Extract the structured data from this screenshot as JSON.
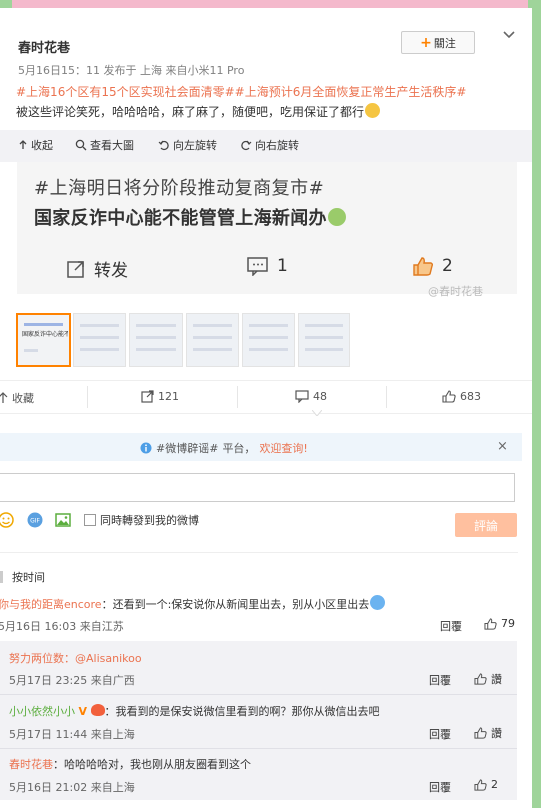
{
  "post": {
    "author": "舂时花巷",
    "follow_label": "關注",
    "meta": "5月16日15：11 发布于 上海 来自小米11 Pro",
    "tag1": "#上海16个区有15个区实现社会面清零#",
    "tag2": "#上海预计6月全面恢复正常生产生活秩序#",
    "body": " 被这些评论笑死，哈哈哈哈，麻了麻了，随便吧，吃用保证了都行"
  },
  "image_toolbar": {
    "collapse": "收起",
    "view_large": "查看大圖",
    "rotate_left": "向左旋转",
    "rotate_right": "向右旋转"
  },
  "image": {
    "line1": "#上海明日将分阶段推动复商复市#",
    "line2": "国家反诈中心能不能管管上海新闻办",
    "forward_label": "转发",
    "comment_count": "1",
    "like_count": "2",
    "watermark": "@舂时花巷",
    "thumb_text": "国家反诈中心能不能管管上海新闻办"
  },
  "actions": {
    "collect": "收藏",
    "forward": "121",
    "comment": "48",
    "like": "683"
  },
  "notice": {
    "tag": "#微博辟谣#",
    "middle": "平台，",
    "link": "欢迎查询!",
    "close": "×"
  },
  "composer": {
    "input_value": "",
    "repost_label": "同時轉發到我的微博",
    "submit_label": "評論"
  },
  "sort": {
    "label": "按时间"
  },
  "comments": [
    {
      "user": "你与我的距离encore",
      "text": "：还看到一个:保安说你从新闻里出去，别从小区里出去",
      "time": "5月16日 16:03 来自江苏",
      "reply_label": "回覆",
      "likes": "79"
    }
  ],
  "replies": [
    {
      "user": "努力两位数",
      "text": "：@Alisanikoo",
      "time": "5月17日 23:25 来自广西",
      "reply_label": "回覆",
      "like_label": "讚"
    },
    {
      "user": "小小依然小小",
      "text": "：我看到的是保安说微信里看到的啊？那你从微信出去吧",
      "time": "5月17日 11:44 来自上海",
      "reply_label": "回覆",
      "like_label": "讚"
    },
    {
      "user": "舂时花巷",
      "text": "：哈哈哈哈对，我也刚从朋友圈看到这个",
      "time": "5月16日 21:02 来自上海",
      "reply_label": "回覆",
      "likes": "2"
    }
  ],
  "colors": {
    "accent": "#ff8200",
    "link": "#eb7350",
    "submit_disabled": "#ffc09f",
    "page_bg": "#9fd49a"
  }
}
